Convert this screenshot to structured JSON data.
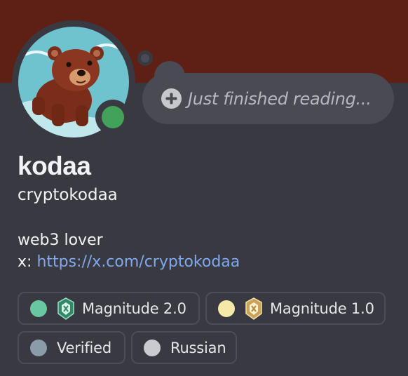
{
  "profile": {
    "display_name": "kodaa",
    "username": "cryptokodaa",
    "status": "online",
    "status_color": "#43a25a",
    "banner_color": "#5e1f14",
    "avatar_icon": "bear-cub-avatar"
  },
  "note": {
    "placeholder": "Just finished reading...",
    "add_icon": "plus-circle-icon"
  },
  "bio": {
    "line1": "web3 lover",
    "link_prefix": "x: ",
    "link_text": "https://x.com/cryptokodaa"
  },
  "roles": [
    {
      "label": "Magnitude 2.0",
      "color": "#69c7a2",
      "icon": "green-badge-icon"
    },
    {
      "label": "Magnitude 1.0",
      "color": "#f5e9a8",
      "icon": "gold-badge-icon"
    },
    {
      "label": "Verified",
      "color": "#8b9ba9",
      "icon": null
    },
    {
      "label": "Russian",
      "color": "#c9cbcf",
      "icon": null
    }
  ]
}
